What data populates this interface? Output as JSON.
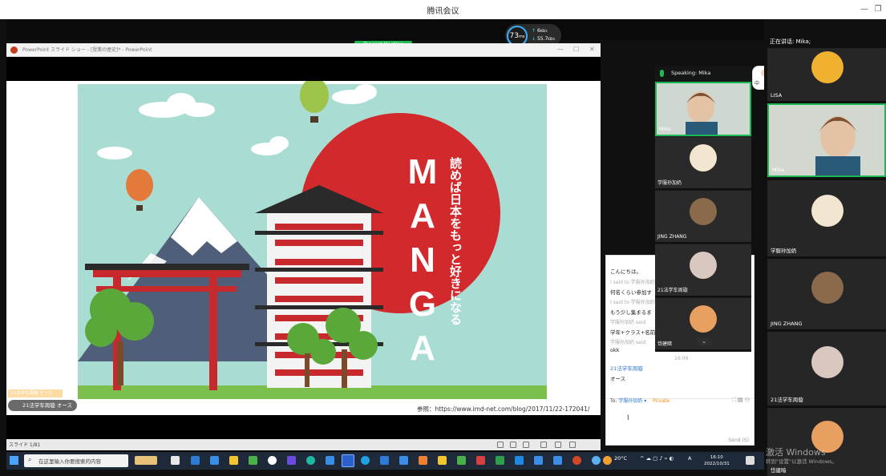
{
  "window": {
    "title": "腾讯会议"
  },
  "network": {
    "latency": "73",
    "latency_unit": "ms",
    "up": "6",
    "up_unit": "KB/s",
    "down": "55.7",
    "down_unit": "KB/s"
  },
  "tencent_tag": "Tencent Meeting",
  "ppt": {
    "title": "PowerPoint スライド ショー - [授業の歴史]* - PowerPoint",
    "slide_counter": "スライド 1/81",
    "reference": "参照：https://www.imd-net.com/blog/2017/11/22-172041/"
  },
  "slide": {
    "big_word": [
      "M",
      "A",
      "N",
      "G",
      "A"
    ],
    "vertical_text": "読めば日本をもっと好きになる"
  },
  "float_chat": {
    "line1": "21法学车周璇 オース",
    "line2": "21法学车周璇 オース"
  },
  "chat": {
    "messages": [
      {
        "type": "msg",
        "text": "こんにちは。"
      },
      {
        "type": "meta",
        "text": "I said to 学服孙加奶"
      },
      {
        "type": "msg",
        "text": "何名くらい参加す"
      },
      {
        "type": "meta",
        "text": "I said to 学服孙加奶"
      },
      {
        "type": "msg",
        "text": "もう少し集まるま"
      },
      {
        "type": "meta",
        "text": "学服孙加奶 said"
      },
      {
        "type": "msg",
        "text": "学年+クラス+名前"
      },
      {
        "type": "meta",
        "text": "学服孙加奶 said"
      },
      {
        "type": "msg",
        "text": "okk"
      },
      {
        "type": "time",
        "text": "16:09"
      },
      {
        "type": "name",
        "text": "21法学车周璇"
      },
      {
        "type": "msg",
        "text": "オース"
      }
    ],
    "to_label": "To:",
    "recipient": "学服孙加奶",
    "private_label": "Private",
    "send_label": "Send (S)"
  },
  "speaker_panel": {
    "header": "Speaking: Mika",
    "tiles": [
      {
        "name": "Mika"
      },
      {
        "name": "学服孙加奶"
      },
      {
        "name": "JING ZHANG"
      },
      {
        "name": "21法学车周璇"
      },
      {
        "name": "岱建暗"
      }
    ]
  },
  "right_panel": {
    "header": "正在讲话: Mika;",
    "tiles": [
      {
        "name": "LISA"
      },
      {
        "name": "Mika"
      },
      {
        "name": "学服孙加奶"
      },
      {
        "name": "JING ZHANG"
      },
      {
        "name": "21法学车周璇"
      },
      {
        "name": "岱建暗"
      }
    ]
  },
  "floating_badge": {
    "left": "中",
    "right": "英"
  },
  "taskbar": {
    "search_placeholder": "在这里输入你要搜索的内容",
    "weather": "20°C",
    "ime": "A",
    "time": "16:10",
    "date": "2022/10/31"
  },
  "watermark": {
    "line1": "激活 Windows",
    "line2": "转到\"设置\"以激活 Windows。"
  }
}
